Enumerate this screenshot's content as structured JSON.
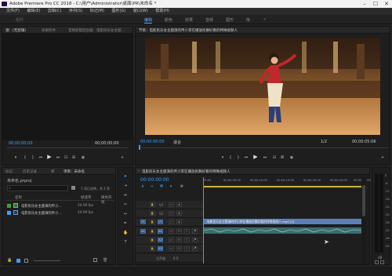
{
  "window": {
    "title": "Adobe Premiere Pro CC 2018 - C:\\用户\\Administrator\\桌面\\PR\\未命名 *"
  },
  "menu": [
    "文件(F)",
    "编辑(E)",
    "剪辑(C)",
    "序列(S)",
    "标记(M)",
    "图形(G)",
    "窗口(W)",
    "帮助(H)"
  ],
  "workspaces": [
    {
      "label": "编辑",
      "active": true
    },
    {
      "label": "颜色",
      "active": false
    },
    {
      "label": "效果",
      "active": false
    },
    {
      "label": "音频",
      "active": false
    },
    {
      "label": "图形",
      "active": false
    },
    {
      "label": "库",
      "active": false
    }
  ],
  "workspace_more": "»",
  "workspace_left": "组件",
  "source": {
    "tabs": [
      "源：(无剪辑)",
      "效果控件",
      "音频剪辑混合器：电影民乐女主题..."
    ],
    "timecode_left": "00;00;00;00",
    "timecode_right": "00;00;00;00"
  },
  "program": {
    "title": "节目：电影民乐女主题演的传小李在播放民舞好看的特殊视频人",
    "timecode": "00:00:00:00",
    "fit": "适合",
    "fraction": "1/2",
    "duration": "00:00:05:06"
  },
  "project": {
    "tabs": [
      "标记",
      "历史记录",
      "库",
      "项目：未命名"
    ],
    "file": "未命名.prproj",
    "search_placeholder": "",
    "count": "1 项已选择，共 2 项",
    "columns": {
      "name": "名称",
      "rate": "帧速率",
      "start": "媒体开始"
    },
    "items": [
      {
        "name": "电影民乐女主题演的传小...",
        "rate": "24.00 fps",
        "color": "#3aa23a"
      },
      {
        "name": "电影民乐女主题演的传小...",
        "rate": "24.00 fps",
        "color": "#3aa0ff"
      }
    ]
  },
  "timeline": {
    "tab": "电影民乐女主题演的传小李在播放民舞好看的特殊视频人",
    "timecode": "00:00:00:00",
    "ruler": [
      "00:00",
      "00:00:05:00",
      "00:00:10:00",
      "00:00:15:00",
      "00:00:20:00",
      "00:00:25:00",
      "00:00:30:00"
    ],
    "video_tracks": [
      "V3",
      "V2",
      "V1"
    ],
    "audio_tracks": [
      "A1",
      "A2",
      "A3"
    ],
    "master": "主声道",
    "master_value": "0.0",
    "clip_label": "电影民乐女主题演的传小李在播放民舞好看的特殊视频人.mp4 [V]"
  },
  "audio_meter": {
    "labels": [
      "0",
      "-6",
      "-12",
      "-18",
      "-24",
      "-30",
      "-36",
      "-42",
      "-48",
      "-54"
    ],
    "bottom": "dB"
  },
  "colors": {
    "accent": "#3aa0ff",
    "video_clip": "#5c7fb8",
    "audio_clip": "#3a6e6e"
  }
}
